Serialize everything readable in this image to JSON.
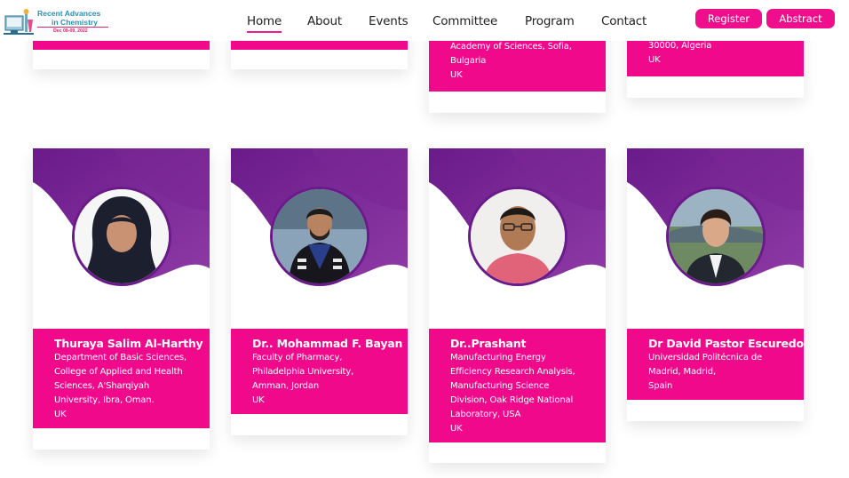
{
  "logo": {
    "line1": "Recent Advances",
    "line2": "in Chemistry",
    "dates": "Dec 08-09, 2022"
  },
  "nav": {
    "items": [
      "Home",
      "About",
      "Events",
      "Committee",
      "Program",
      "Contact"
    ],
    "active": "Home"
  },
  "buttons": {
    "register": "Register",
    "abstract": "Abstract"
  },
  "top_cards": [
    {
      "lines": []
    },
    {
      "lines": []
    },
    {
      "lines": [
        "Academy of Sciences, Sofia,",
        "Bulgaria",
        "UK"
      ]
    },
    {
      "lines": [
        "30000, Algeria",
        "UK"
      ]
    }
  ],
  "speakers": [
    {
      "name": "Thuraya Salim Al-Harthy",
      "lines": [
        "Department of Basic Sciences,",
        "College of Applied and Health",
        "Sciences, A'Sharqiyah",
        "University, Ibra, Oman.",
        "UK"
      ]
    },
    {
      "name": "Dr.. Mohammad F. Bayan",
      "lines": [
        "Faculty of Pharmacy,",
        "Philadelphia University,",
        "Amman, Jordan",
        "UK"
      ]
    },
    {
      "name": "Dr..Prashant",
      "lines": [
        "Manufacturing Energy",
        "Efficiency Research Analysis,",
        "Manufacturing Science",
        "Division, Oak Ridge National",
        "Laboratory, USA",
        "UK"
      ]
    },
    {
      "name": "Dr David Pastor Escuredo",
      "lines": [
        "Universidad Politécnica de",
        "Madrid, Madrid,",
        "Spain"
      ]
    }
  ],
  "colors": {
    "accent": "#ef0e8b",
    "purple": "#6a1b8a",
    "purple_light": "#8e3aa6"
  }
}
